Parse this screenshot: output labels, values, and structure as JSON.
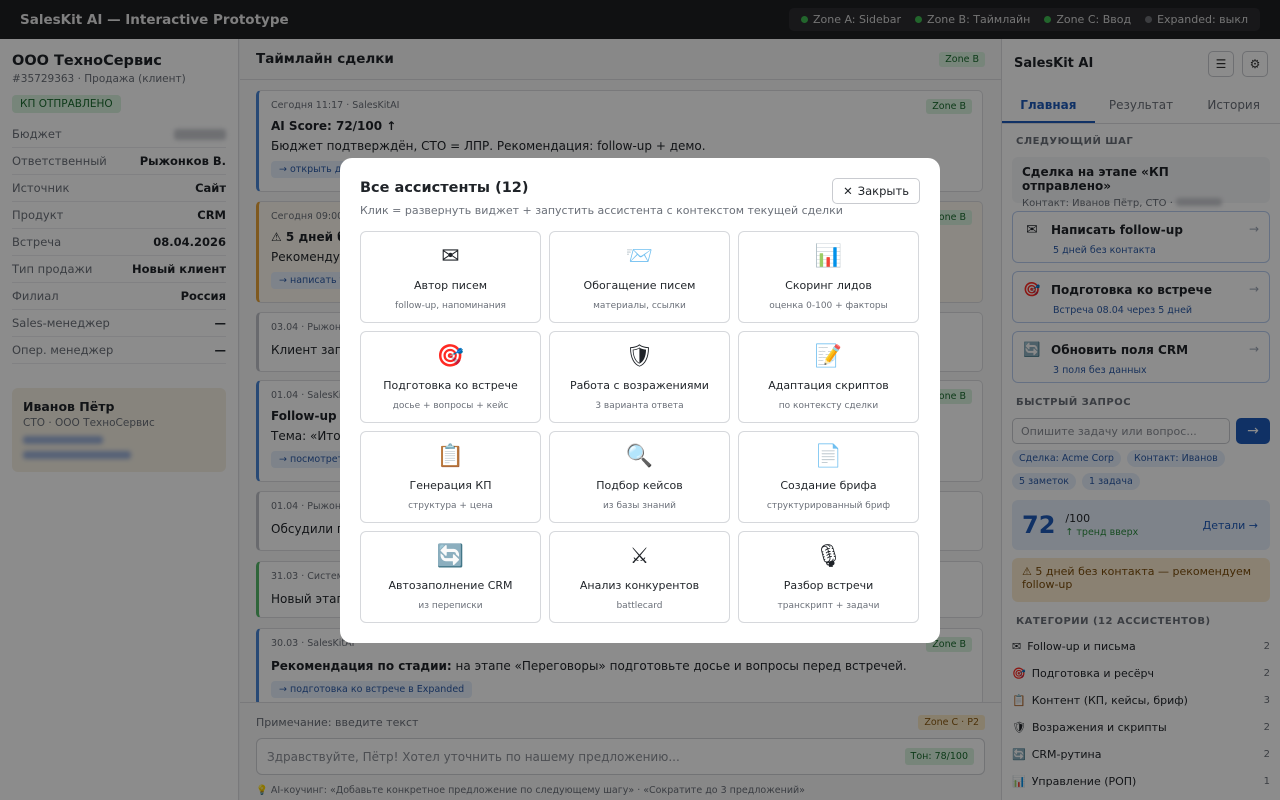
{
  "topbar": {
    "title": "SalesKit AI — Interactive Prototype",
    "zones": [
      {
        "label": "Zone A: Sidebar",
        "active": true
      },
      {
        "label": "Zone B: Таймлайн",
        "active": true
      },
      {
        "label": "Zone C: Ввод",
        "active": true
      },
      {
        "label": "Expanded: выкл",
        "active": false
      }
    ]
  },
  "deal": {
    "company": "ООО ТехноСервис",
    "id_line": "#35729363 · Продажа (клиент)",
    "status": "КП ОТПРАВЛЕНО",
    "props": [
      {
        "key": "Бюджет",
        "value": ""
      },
      {
        "key": "Ответственный",
        "value": "Рыжонков В."
      },
      {
        "key": "Источник",
        "value": "Сайт"
      },
      {
        "key": "Продукт",
        "value": "CRM"
      },
      {
        "key": "Встреча",
        "value": "08.04.2026"
      },
      {
        "key": "Тип продажи",
        "value": "Новый клиент"
      },
      {
        "key": "Филиал",
        "value": "Россия"
      },
      {
        "key": "Sales-менеджер",
        "value": "—"
      },
      {
        "key": "Опер. менеджер",
        "value": "—"
      }
    ],
    "contact": {
      "name": "Иванов Пётр",
      "role": "CTO · ООО ТехноСервис"
    }
  },
  "timeline": {
    "title": "Таймлайн сделки",
    "zone_badge": "Zone B",
    "items": [
      {
        "meta": "Сегодня 11:17 · SalesKitAI",
        "title": "AI Score: 72/100 ↑",
        "text": "Бюджет подтверждён, CTO = ЛПР. Рекомендация: follow-up + демо.",
        "chip": "→ открыть де",
        "badge": "Zone B"
      },
      {
        "meta": "Сегодня 09:00 ·",
        "title": "⚠ 5 дней бе",
        "text": "Рекомендуе",
        "chip": "→ написать fo",
        "badge": "Zone B"
      },
      {
        "meta": "03.04 · Рыжонк",
        "title": "",
        "text": "Клиент запр",
        "chip": "",
        "badge": ""
      },
      {
        "meta": "01.04 · SalesKitA",
        "title": "Follow-up с",
        "text": "Тема: «Итоги",
        "chip": "→ посмотрет",
        "badge": "Zone B"
      },
      {
        "meta": "01.04 · Рыжонк",
        "title": "",
        "text": "Обсудили по",
        "chip": "",
        "badge": ""
      },
      {
        "meta": "31.03 · Система",
        "title": "",
        "text": "Новый этап:",
        "chip": "",
        "badge": ""
      },
      {
        "meta": "30.03 · SalesKitAI",
        "title": "",
        "text_bold": "Рекомендация по стадии:",
        "text": " на этапе «Переговоры» подготовьте досье и вопросы перед встречей.",
        "chip": "→ подготовка ко встрече в Expanded",
        "badge": "Zone B"
      }
    ]
  },
  "composer": {
    "note_label": "Примечание: введите текст",
    "zone_badge": "Zone C · P2",
    "placeholder": "Здравствуйте, Пётр! Хотел уточнить по нашему предложению...",
    "tone": "Тон: 78/100",
    "coach": "💡 AI-коучинг: «Добавьте конкретное предложение по следующему шагу» · «Сократите до 3 предложений»"
  },
  "sidebar": {
    "title": "SalesKit AI",
    "tabs": [
      "Главная",
      "Результат",
      "История"
    ],
    "next_step_label": "СЛЕДУЮЩИЙ ШАГ",
    "next_card": {
      "title": "Сделка на этапе «КП отправлено»",
      "sub": "Контакт: Иванов Пётр, CTO ·"
    },
    "actions": [
      {
        "icon": "✉",
        "title": "Написать follow-up",
        "sub": "5 дней без контакта"
      },
      {
        "icon": "🎯",
        "title": "Подготовка ко встрече",
        "sub": "Встреча 08.04 через 5 дней"
      },
      {
        "icon": "🔄",
        "title": "Обновить поля CRM",
        "sub": "3 поля без данных"
      }
    ],
    "quick_label": "БЫСТРЫЙ ЗАПРОС",
    "quick_placeholder": "Опишите задачу или вопрос...",
    "chips": [
      "Сделка: Acme Corp",
      "Контакт: Иванов",
      "5 заметок",
      "1 задача"
    ],
    "score": {
      "value": "72",
      "of": "/100",
      "trend": "↑ тренд вверх",
      "link": "Детали →"
    },
    "warning": "⚠ 5 дней без контакта — рекомендуем follow-up",
    "categories_label": "КАТЕГОРИИ (12 АССИСТЕНТОВ)",
    "categories": [
      {
        "icon": "✉",
        "label": "Follow-up и письма",
        "count": "2"
      },
      {
        "icon": "🎯",
        "label": "Подготовка и ресёрч",
        "count": "2"
      },
      {
        "icon": "📋",
        "label": "Контент (КП, кейсы, бриф)",
        "count": "3"
      },
      {
        "icon": "🛡",
        "label": "Возражения и скрипты",
        "count": "2"
      },
      {
        "icon": "🔄",
        "label": "CRM-рутина",
        "count": "2"
      },
      {
        "icon": "📊",
        "label": "Управление (РОП)",
        "count": "1"
      }
    ]
  },
  "modal": {
    "title": "Все ассистенты (12)",
    "subtitle": "Клик = развернуть виджет + запустить ассистента с контекстом текущей сделки",
    "close_label": "Закрыть",
    "assistants": [
      {
        "icon": "✉",
        "name": "Автор писем",
        "desc": "follow-up, напоминания"
      },
      {
        "icon": "📨",
        "name": "Обогащение писем",
        "desc": "материалы, ссылки"
      },
      {
        "icon": "📊",
        "name": "Скоринг лидов",
        "desc": "оценка 0-100 + факторы"
      },
      {
        "icon": "🎯",
        "name": "Подготовка ко встрече",
        "desc": "досье + вопросы + кейс"
      },
      {
        "icon": "🛡",
        "name": "Работа с возражениями",
        "desc": "3 варианта ответа"
      },
      {
        "icon": "📝",
        "name": "Адаптация скриптов",
        "desc": "по контексту сделки"
      },
      {
        "icon": "📋",
        "name": "Генерация КП",
        "desc": "структура + цена"
      },
      {
        "icon": "🔍",
        "name": "Подбор кейсов",
        "desc": "из базы знаний"
      },
      {
        "icon": "📄",
        "name": "Создание брифа",
        "desc": "структурированный бриф"
      },
      {
        "icon": "🔄",
        "name": "Автозаполнение CRM",
        "desc": "из переписки"
      },
      {
        "icon": "⚔",
        "name": "Анализ конкурентов",
        "desc": "battlecard"
      },
      {
        "icon": "🎙",
        "name": "Разбор встречи",
        "desc": "транскрипт + задачи"
      }
    ]
  }
}
